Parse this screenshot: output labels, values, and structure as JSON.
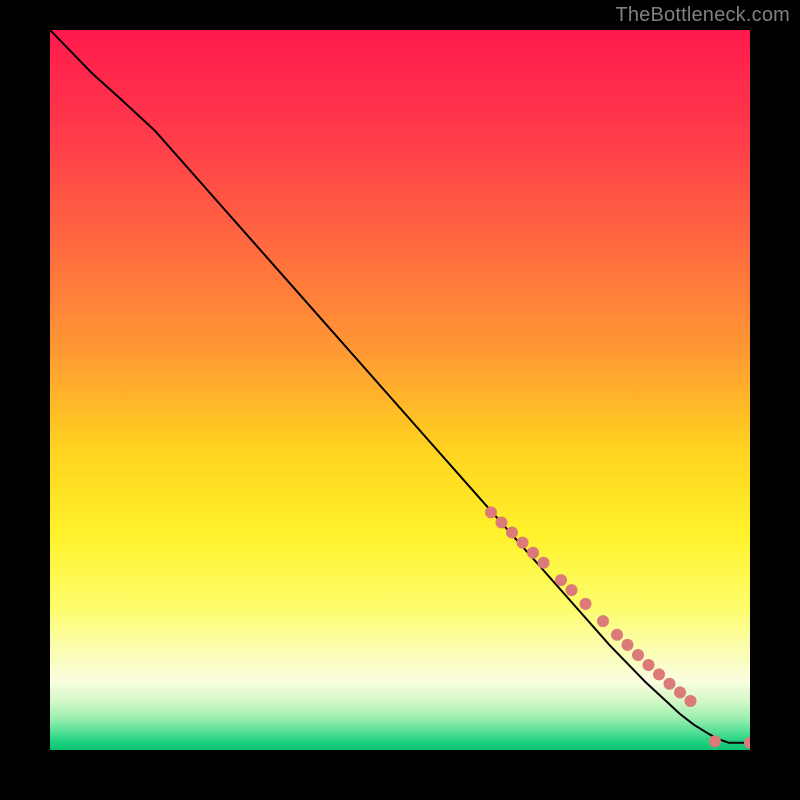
{
  "attribution": "TheBottleneck.com",
  "chart_data": {
    "type": "line",
    "title": "",
    "xlabel": "",
    "ylabel": "",
    "xlim": [
      0,
      100
    ],
    "ylim": [
      0,
      100
    ],
    "grid": false,
    "legend": false,
    "background_gradient": {
      "stops": [
        {
          "offset": 0.0,
          "color": "#ff1a4d"
        },
        {
          "offset": 0.15,
          "color": "#ff3b4a"
        },
        {
          "offset": 0.3,
          "color": "#ff6a3f"
        },
        {
          "offset": 0.45,
          "color": "#ff9a33"
        },
        {
          "offset": 0.58,
          "color": "#ffd21f"
        },
        {
          "offset": 0.7,
          "color": "#fff22a"
        },
        {
          "offset": 0.8,
          "color": "#fdfd6a"
        },
        {
          "offset": 0.86,
          "color": "#fbfdb0"
        },
        {
          "offset": 0.905,
          "color": "#f9fde0"
        },
        {
          "offset": 0.93,
          "color": "#d8f8c8"
        },
        {
          "offset": 0.955,
          "color": "#9eeeb0"
        },
        {
          "offset": 0.975,
          "color": "#54e096"
        },
        {
          "offset": 0.99,
          "color": "#1bd07f"
        },
        {
          "offset": 1.0,
          "color": "#0cc474"
        }
      ]
    },
    "series": [
      {
        "name": "bottleneck-curve",
        "type": "line",
        "color": "#000000",
        "x": [
          0,
          3,
          6,
          10,
          15,
          20,
          25,
          30,
          35,
          40,
          45,
          50,
          55,
          60,
          65,
          70,
          75,
          80,
          85,
          88,
          90,
          92,
          94,
          95.5,
          97,
          100
        ],
        "y": [
          100,
          97,
          94,
          90.5,
          86,
          80.5,
          75,
          69.5,
          64,
          58.5,
          53,
          47.5,
          42,
          36.5,
          31,
          25.5,
          20,
          14.5,
          9.5,
          6.8,
          5.0,
          3.5,
          2.3,
          1.5,
          1.0,
          1.0
        ]
      },
      {
        "name": "curve-markers",
        "type": "scatter",
        "color": "#db7a78",
        "radius": 6,
        "x": [
          63,
          64.5,
          66,
          67.5,
          69,
          70.5,
          73,
          74.5,
          76.5,
          79,
          81,
          82.5,
          84,
          85.5,
          87,
          88.5,
          90,
          91.5,
          95,
          100
        ],
        "y": [
          33,
          31.6,
          30.2,
          28.8,
          27.4,
          26.0,
          23.6,
          22.2,
          20.3,
          17.9,
          16.0,
          14.6,
          13.2,
          11.8,
          10.5,
          9.2,
          8.0,
          6.8,
          1.2,
          1.0
        ]
      }
    ]
  }
}
